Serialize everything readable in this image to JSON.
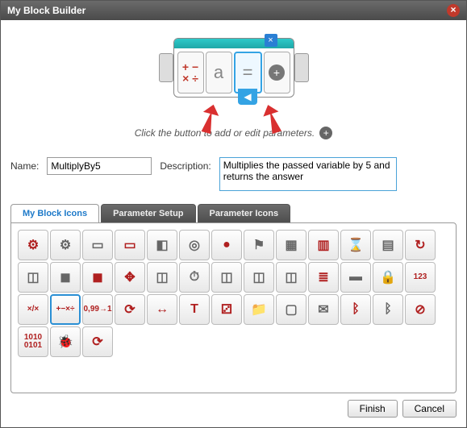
{
  "window": {
    "title": "My Block Builder"
  },
  "preview": {
    "slot1_symbols": "+ −\n× ÷",
    "slot2_label": "a",
    "slot3_label": "=",
    "close_tab": "×",
    "hint": "Click the button to add or edit parameters."
  },
  "fields": {
    "name_label": "Name:",
    "name_value": "MultiplyBy5",
    "desc_label": "Description:",
    "desc_value": "Multiplies the passed variable by 5 and returns the answer"
  },
  "tabs": {
    "t1": "My Block Icons",
    "t2": "Parameter Setup",
    "t3": "Parameter Icons"
  },
  "icons": [
    {
      "k": "gears-red",
      "g": "⚙"
    },
    {
      "k": "gears-gray",
      "g": "⚙",
      "gray": true
    },
    {
      "k": "motor1",
      "g": "▭",
      "gray": true
    },
    {
      "k": "motor-red",
      "g": "▭"
    },
    {
      "k": "motor2",
      "g": "◧",
      "gray": true
    },
    {
      "k": "steer",
      "g": "◎",
      "gray": true
    },
    {
      "k": "ball-red",
      "g": "●"
    },
    {
      "k": "sign",
      "g": "⚑",
      "gray": true
    },
    {
      "k": "block1",
      "g": "▦",
      "gray": true
    },
    {
      "k": "block2",
      "g": "▥"
    },
    {
      "k": "hourglass",
      "g": "⌛"
    },
    {
      "k": "block3",
      "g": "▤",
      "gray": true
    },
    {
      "k": "sync",
      "g": "↻"
    },
    {
      "k": "cube1",
      "g": "◫",
      "gray": true
    },
    {
      "k": "cube-dark",
      "g": "◼",
      "gray": true
    },
    {
      "k": "cube-red",
      "g": "◼"
    },
    {
      "k": "dpad",
      "g": "✥"
    },
    {
      "k": "cube2",
      "g": "◫",
      "gray": true
    },
    {
      "k": "stopwatch",
      "g": "⏱",
      "gray": true
    },
    {
      "k": "cube3",
      "g": "◫",
      "gray": true
    },
    {
      "k": "cube4",
      "g": "◫",
      "gray": true
    },
    {
      "k": "cube5",
      "g": "◫",
      "gray": true
    },
    {
      "k": "stack",
      "g": "≣"
    },
    {
      "k": "case1",
      "g": "▬",
      "gray": true
    },
    {
      "k": "case-lock",
      "g": "🔒",
      "gray": true
    },
    {
      "k": "digits",
      "g": "123"
    },
    {
      "k": "divide-x",
      "g": "×/×"
    },
    {
      "k": "ops",
      "g": "+−×÷",
      "sel": true
    },
    {
      "k": "round",
      "g": "0,99→1"
    },
    {
      "k": "swirl",
      "g": "⟳"
    },
    {
      "k": "width",
      "g": "↔"
    },
    {
      "k": "text-t",
      "g": "T"
    },
    {
      "k": "dice",
      "g": "⚂"
    },
    {
      "k": "folder",
      "g": "📁"
    },
    {
      "k": "monitor",
      "g": "▢",
      "gray": true
    },
    {
      "k": "mail",
      "g": "✉",
      "gray": true
    },
    {
      "k": "bt1",
      "g": "ᛒ"
    },
    {
      "k": "bt2",
      "g": "ᛒ",
      "gray": true
    },
    {
      "k": "no",
      "g": "⊘"
    },
    {
      "k": "binary",
      "g": "1010\n0101"
    },
    {
      "k": "ladybug",
      "g": "🐞"
    },
    {
      "k": "swirl2",
      "g": "⟳"
    }
  ],
  "footer": {
    "finish": "Finish",
    "cancel": "Cancel"
  }
}
